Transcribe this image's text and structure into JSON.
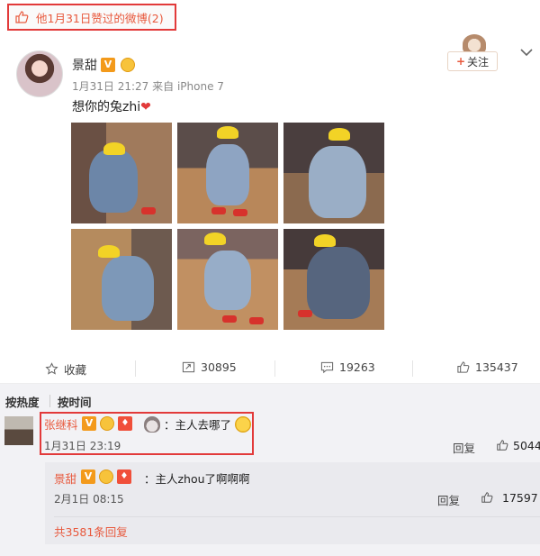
{
  "liked_bar": {
    "text": "他1月31日赞过的微博(2)"
  },
  "post": {
    "username": "景甜",
    "v_badge": "V",
    "time": "1月31日 21:27",
    "source": "来自 iPhone 7",
    "text": "想你的兔zhi",
    "heart": "❤",
    "follow_label": "关注",
    "follow_plus": "+",
    "menu_icon": "chevron-down-icon",
    "photo_count": 6
  },
  "actions": {
    "collect_label": "收藏",
    "repost_count": "30895",
    "comment_count": "19263",
    "like_count": "135437"
  },
  "comments": {
    "sort_hot": "按热度",
    "sort_time": "按时间",
    "items": [
      {
        "name": "张继科",
        "v_badge": "V",
        "text": "：主人去哪了",
        "time": "1月31日 23:19",
        "reply_label": "回复",
        "likes": "5044",
        "replies": [
          {
            "name": "景甜",
            "v_badge": "V",
            "text": "：主人zhou了啊啊啊",
            "time": "2月1日 08:15",
            "reply_label": "回复",
            "likes": "17597"
          }
        ],
        "more_replies": "共3581条回复"
      }
    ]
  },
  "colors": {
    "accent_red": "#e23a3a",
    "brand_orange": "#e8593d",
    "badge_orange": "#f39a1b"
  }
}
